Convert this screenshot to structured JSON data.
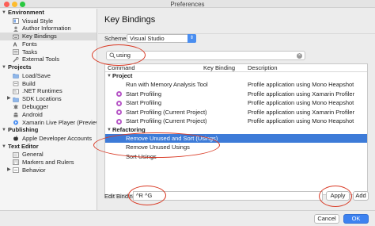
{
  "window": {
    "title": "Preferences"
  },
  "sidebar": {
    "sections": [
      {
        "label": "Environment",
        "items": [
          {
            "label": "Visual Style",
            "icon": "visual-style-icon"
          },
          {
            "label": "Author Information",
            "icon": "author-icon"
          },
          {
            "label": "Key Bindings",
            "icon": "keyboard-icon",
            "selected": true
          },
          {
            "label": "Fonts",
            "icon": "fonts-icon"
          },
          {
            "label": "Tasks",
            "icon": "tasks-icon"
          },
          {
            "label": "External Tools",
            "icon": "tools-icon"
          }
        ]
      },
      {
        "label": "Projects",
        "items": [
          {
            "label": "Load/Save",
            "icon": "folder-icon"
          },
          {
            "label": "Build",
            "icon": "build-icon"
          },
          {
            "label": ".NET Runtimes",
            "icon": "runtime-icon"
          },
          {
            "label": "SDK Locations",
            "icon": "folder-icon",
            "expandable": true
          },
          {
            "label": "Debugger",
            "icon": "debugger-icon"
          },
          {
            "label": "Android",
            "icon": "android-icon"
          },
          {
            "label": "Xamarin Live Player (Preview)",
            "icon": "live-player-icon"
          }
        ]
      },
      {
        "label": "Publishing",
        "items": [
          {
            "label": "Apple Developer Accounts",
            "icon": "apple-icon"
          }
        ]
      },
      {
        "label": "Text Editor",
        "items": [
          {
            "label": "General",
            "icon": "text-editor-icon"
          },
          {
            "label": "Markers and Rulers",
            "icon": "markers-icon"
          },
          {
            "label": "Behavior",
            "icon": "behavior-icon",
            "expandable": true
          }
        ]
      }
    ]
  },
  "main": {
    "title": "Key Bindings",
    "scheme_label": "Scheme:",
    "scheme_value": "Visual Studio",
    "search_value": "using",
    "columns": [
      "Command",
      "Key Binding",
      "Description"
    ],
    "groups": [
      {
        "label": "Project",
        "rows": [
          {
            "command": "Run with Memory Analysis Tool",
            "binding": "",
            "description": "Profile application using Mono Heapshot",
            "icon": ""
          },
          {
            "command": "Start Profiling",
            "binding": "",
            "description": "Profile application using Xamarin Profiler",
            "icon": "profiler-icon"
          },
          {
            "command": "Start Profiling",
            "binding": "",
            "description": "Profile application using Mono Heapshot",
            "icon": "profiler-icon"
          },
          {
            "command": "Start Profiling (Current Project)",
            "binding": "",
            "description": "Profile application using Xamarin Profiler",
            "icon": "profiler-icon"
          },
          {
            "command": "Start Profiling (Current Project)",
            "binding": "",
            "description": "Profile application using Mono Heapshot",
            "icon": "profiler-icon"
          }
        ]
      },
      {
        "label": "Refactoring",
        "rows": [
          {
            "command": "Remove Unused and Sort (Usings)",
            "binding": "",
            "description": "",
            "selected": true
          },
          {
            "command": "Remove Unused Usings",
            "binding": "",
            "description": ""
          },
          {
            "command": "Sort Usings",
            "binding": "",
            "description": ""
          }
        ]
      }
    ],
    "edit_label": "Edit Binding",
    "edit_value": "^R ^G",
    "apply_label": "Apply",
    "add_label": "Add"
  },
  "footer": {
    "cancel_label": "Cancel",
    "ok_label": "OK"
  },
  "colors": {
    "accent": "#3d7bd8",
    "annotation": "#d93a25",
    "profiler_icon": "#b656c6"
  }
}
